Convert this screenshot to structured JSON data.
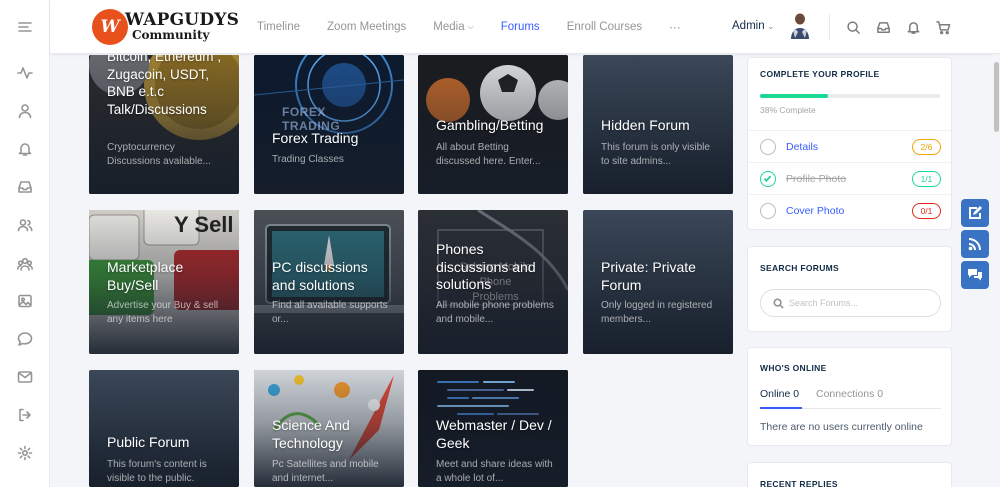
{
  "brand": {
    "logo_mark": "W",
    "name": "WAPGUDYS",
    "tagline": "Community",
    "accent_color": "#385dff",
    "logo_color": "#e8501c"
  },
  "sidebar": {
    "items": [
      {
        "icon": "menu-icon"
      },
      {
        "icon": "activity-icon"
      },
      {
        "icon": "profile-icon"
      },
      {
        "icon": "notifications-icon"
      },
      {
        "icon": "inbox-icon"
      },
      {
        "icon": "friends-icon"
      },
      {
        "icon": "groups-icon"
      },
      {
        "icon": "photos-icon"
      },
      {
        "icon": "forums-icon"
      },
      {
        "icon": "email-icon"
      },
      {
        "icon": "logout-icon"
      },
      {
        "icon": "settings-icon"
      }
    ]
  },
  "header": {
    "nav": [
      {
        "label": "Timeline"
      },
      {
        "label": "Zoom Meetings"
      },
      {
        "label": "Media",
        "dropdown": true
      },
      {
        "label": "Forums",
        "active": true
      },
      {
        "label": "Enroll Courses"
      },
      {
        "label": "⋯"
      }
    ],
    "user": "Admin",
    "icons": [
      "search-icon",
      "inbox-icon",
      "bell-icon",
      "cart-icon"
    ]
  },
  "forums": [
    {
      "title": "Bitcoin, Ethereum , Zugacoin, USDT, BNB e.t.c Talk/Discussions",
      "desc": "Cryptocurrency Discussions available..."
    },
    {
      "title": "Forex Trading",
      "desc": "Trading Classes",
      "image_text": "FOREX TRADING"
    },
    {
      "title": "Gambling/Betting",
      "desc": "All about Betting discussed here. Enter..."
    },
    {
      "title": "Hidden Forum",
      "desc": "This forum is only visible to site admins..."
    },
    {
      "title": "Marketplace Buy/Sell",
      "desc": "Advertise your Buy & sell any items here",
      "image_text": "Y Sell"
    },
    {
      "title": "PC discussions and solutions",
      "desc": "Find all available supports or..."
    },
    {
      "title": "Phones discussions and solutions",
      "desc": "All mobile phone problems and mobile...",
      "image_text": "Solving Mobile Phone Problems"
    },
    {
      "title": "Private: Private Forum",
      "desc": "Only logged in registered members..."
    },
    {
      "title": "Public Forum",
      "desc": "This forum's content is visible to the public."
    },
    {
      "title": "Science And Technology",
      "desc": "Pc Satellites and mobile and internet..."
    },
    {
      "title": "Webmaster / Dev / Geek",
      "desc": "Meet and share ideas with a whole lot of..."
    }
  ],
  "profile_widget": {
    "title": "COMPLETE YOUR PROFILE",
    "progress": 0.38,
    "progress_label": "38% Complete",
    "items": [
      {
        "label": "Details",
        "count": "2/6",
        "state": "partial",
        "color": "#f0a500"
      },
      {
        "label": "Profile Photo",
        "count": "1/1",
        "state": "done",
        "color": "#1cd991"
      },
      {
        "label": "Cover Photo",
        "count": "0/1",
        "state": "empty",
        "color": "#e8271c"
      }
    ]
  },
  "search_widget": {
    "title": "SEARCH FORUMS",
    "placeholder": "Search Forums..."
  },
  "online_widget": {
    "title": "WHO'S ONLINE",
    "tabs": [
      {
        "label": "Online",
        "count": "0"
      },
      {
        "label": "Connections",
        "count": "0"
      }
    ],
    "tab_online": "Online 0",
    "tab_connections": "Connections 0",
    "note": "There are no users currently online"
  },
  "replies_widget": {
    "title": "RECENT REPLIES"
  },
  "floating_actions": [
    "edit-icon",
    "feed-icon",
    "chat-icon"
  ]
}
